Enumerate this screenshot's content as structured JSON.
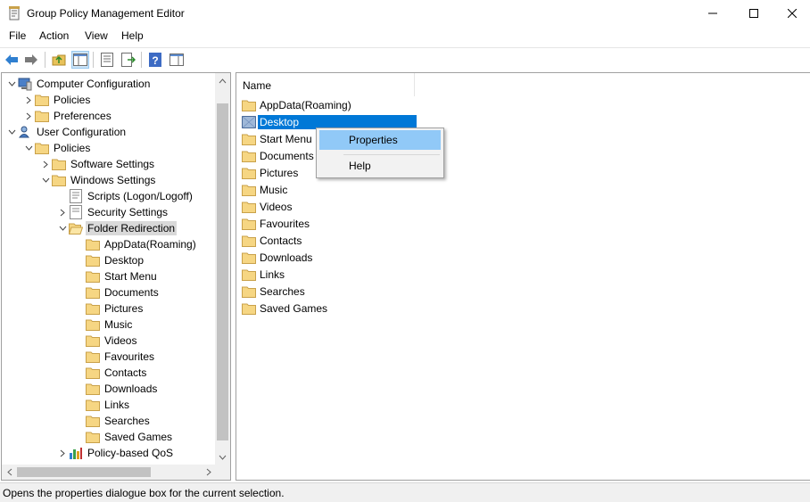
{
  "window": {
    "title": "Group Policy Management Editor",
    "accent": "#0078d7"
  },
  "menu": [
    "File",
    "Action",
    "View",
    "Help"
  ],
  "toolbar_icons": [
    "back-arrow-icon",
    "forward-arrow-icon",
    "up-folder-icon",
    "show-hide-tree-icon",
    "properties-icon",
    "export-list-icon",
    "help-icon",
    "show-action-pane-icon"
  ],
  "tree": {
    "computer_configuration": "Computer Configuration",
    "cc_policies": "Policies",
    "cc_preferences": "Preferences",
    "user_configuration": "User Configuration",
    "uc_policies": "Policies",
    "software_settings": "Software Settings",
    "windows_settings": "Windows Settings",
    "scripts": "Scripts (Logon/Logoff)",
    "security_settings": "Security Settings",
    "folder_redirection": "Folder Redirection",
    "redirect_items": [
      "AppData(Roaming)",
      "Desktop",
      "Start Menu",
      "Documents",
      "Pictures",
      "Music",
      "Videos",
      "Favourites",
      "Contacts",
      "Downloads",
      "Links",
      "Searches",
      "Saved Games"
    ],
    "policy_qos": "Policy-based QoS"
  },
  "list": {
    "column_name": "Name",
    "items": [
      "AppData(Roaming)",
      "Desktop",
      "Start Menu",
      "Documents",
      "Pictures",
      "Music",
      "Videos",
      "Favourites",
      "Contacts",
      "Downloads",
      "Links",
      "Searches",
      "Saved Games"
    ],
    "selected": "Desktop"
  },
  "context_menu": {
    "properties": "Properties",
    "help": "Help"
  },
  "status": "Opens the properties dialogue box for the current selection."
}
